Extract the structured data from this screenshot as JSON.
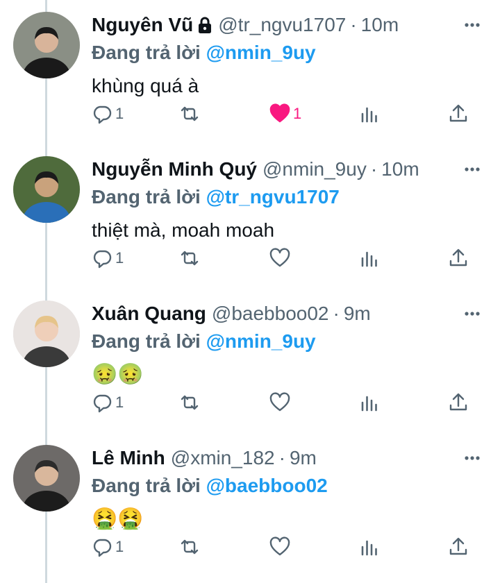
{
  "tweets": [
    {
      "name": "Nguyên Vũ",
      "protected": true,
      "handle": "@tr_ngvu1707",
      "time": "10m",
      "reply_prefix": "Đang trả lời",
      "reply_to": "@nmin_9uy",
      "text": "khùng quá à",
      "replies": "1",
      "likes": "1",
      "liked": true,
      "avatar_colors": {
        "bg": "#8a8f85",
        "skin": "#d8b49a",
        "shirt": "#1a1a1a"
      }
    },
    {
      "name": "Nguyễn Minh Quý",
      "protected": false,
      "handle": "@nmin_9uy",
      "time": "10m",
      "reply_prefix": "Đang trả lời",
      "reply_to": "@tr_ngvu1707",
      "text": "thiệt mà, moah moah",
      "replies": "1",
      "likes": "",
      "liked": false,
      "avatar_colors": {
        "bg": "#4f6b3c",
        "skin": "#c9a27c",
        "shirt": "#2a6fb8"
      }
    },
    {
      "name": "Xuân Quang",
      "protected": false,
      "handle": "@baebboo02",
      "time": "9m",
      "reply_prefix": "Đang trả lời",
      "reply_to": "@nmin_9uy",
      "text": "🤢🤢",
      "replies": "1",
      "likes": "",
      "liked": false,
      "avatar_colors": {
        "bg": "#e9e4e2",
        "skin": "#efcfb9",
        "shirt": "#3a3a3a"
      }
    },
    {
      "name": "Lê Minh",
      "protected": false,
      "handle": "@xmin_182",
      "time": "9m",
      "reply_prefix": "Đang trả lời",
      "reply_to": "@baebboo02",
      "text": "🤮🤮",
      "replies": "1",
      "likes": "",
      "liked": false,
      "avatar_colors": {
        "bg": "#6d6a68",
        "skin": "#d9b79c",
        "shirt": "#1c1c1c"
      }
    }
  ],
  "separator": "·",
  "colors": {
    "text": "#0f1419",
    "secondary": "#536471",
    "link": "#1d9bf0",
    "like": "#f91880",
    "thread_line": "#cfd9de"
  },
  "icons": [
    "lock-icon",
    "more-icon",
    "reply-icon",
    "retweet-icon",
    "like-icon",
    "stats-icon",
    "share-icon"
  ]
}
